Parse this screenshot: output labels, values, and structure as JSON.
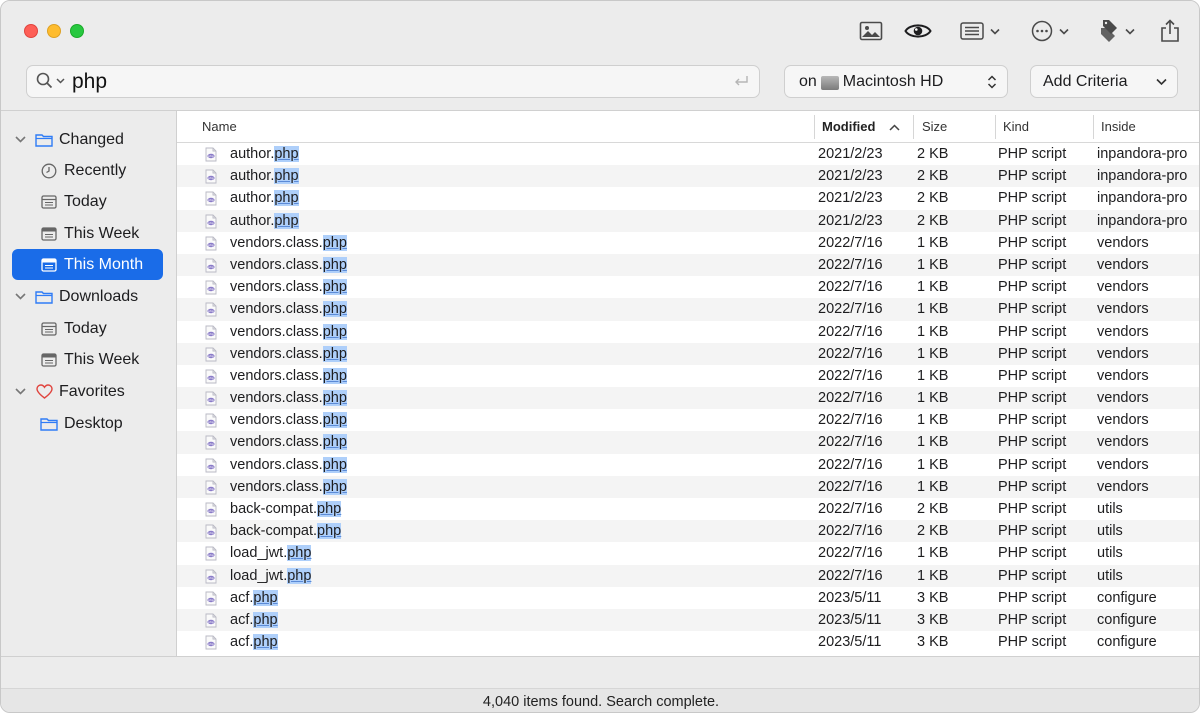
{
  "search": {
    "query": "php"
  },
  "scope": {
    "prefix": "on",
    "volume": "Macintosh HD"
  },
  "criteria": {
    "label": "Add Criteria"
  },
  "toolbar": {
    "icons": [
      "image-icon",
      "eye-icon",
      "list-view-icon",
      "more-icon",
      "tags-icon",
      "share-icon"
    ]
  },
  "sidebar": {
    "groups": [
      {
        "label": "Changed",
        "items": [
          {
            "label": "Recently",
            "icon": "clock-icon"
          },
          {
            "label": "Today",
            "icon": "calendar-icon"
          },
          {
            "label": "This Week",
            "icon": "calendar-icon"
          },
          {
            "label": "This Month",
            "icon": "calendar-icon",
            "selected": true
          }
        ]
      },
      {
        "label": "Downloads",
        "items": [
          {
            "label": "Today",
            "icon": "calendar-icon"
          },
          {
            "label": "This Week",
            "icon": "calendar-icon"
          }
        ]
      },
      {
        "label": "Favorites",
        "items": [
          {
            "label": "Desktop",
            "icon": "folder-icon"
          }
        ]
      }
    ]
  },
  "columns": {
    "name": "Name",
    "modified": "Modified",
    "size": "Size",
    "kind": "Kind",
    "inside": "Inside"
  },
  "rows": [
    {
      "base": "author.",
      "ext": "php",
      "modified": "2021/2/23",
      "size": "2 KB",
      "kind": "PHP script",
      "inside": "inpandora-pro"
    },
    {
      "base": "author.",
      "ext": "php",
      "modified": "2021/2/23",
      "size": "2 KB",
      "kind": "PHP script",
      "inside": "inpandora-pro"
    },
    {
      "base": "author.",
      "ext": "php",
      "modified": "2021/2/23",
      "size": "2 KB",
      "kind": "PHP script",
      "inside": "inpandora-pro"
    },
    {
      "base": "author.",
      "ext": "php",
      "modified": "2021/2/23",
      "size": "2 KB",
      "kind": "PHP script",
      "inside": "inpandora-pro"
    },
    {
      "base": "vendors.class.",
      "ext": "php",
      "modified": "2022/7/16",
      "size": "1 KB",
      "kind": "PHP script",
      "inside": "vendors"
    },
    {
      "base": "vendors.class.",
      "ext": "php",
      "modified": "2022/7/16",
      "size": "1 KB",
      "kind": "PHP script",
      "inside": "vendors"
    },
    {
      "base": "vendors.class.",
      "ext": "php",
      "modified": "2022/7/16",
      "size": "1 KB",
      "kind": "PHP script",
      "inside": "vendors"
    },
    {
      "base": "vendors.class.",
      "ext": "php",
      "modified": "2022/7/16",
      "size": "1 KB",
      "kind": "PHP script",
      "inside": "vendors"
    },
    {
      "base": "vendors.class.",
      "ext": "php",
      "modified": "2022/7/16",
      "size": "1 KB",
      "kind": "PHP script",
      "inside": "vendors"
    },
    {
      "base": "vendors.class.",
      "ext": "php",
      "modified": "2022/7/16",
      "size": "1 KB",
      "kind": "PHP script",
      "inside": "vendors"
    },
    {
      "base": "vendors.class.",
      "ext": "php",
      "modified": "2022/7/16",
      "size": "1 KB",
      "kind": "PHP script",
      "inside": "vendors"
    },
    {
      "base": "vendors.class.",
      "ext": "php",
      "modified": "2022/7/16",
      "size": "1 KB",
      "kind": "PHP script",
      "inside": "vendors"
    },
    {
      "base": "vendors.class.",
      "ext": "php",
      "modified": "2022/7/16",
      "size": "1 KB",
      "kind": "PHP script",
      "inside": "vendors"
    },
    {
      "base": "vendors.class.",
      "ext": "php",
      "modified": "2022/7/16",
      "size": "1 KB",
      "kind": "PHP script",
      "inside": "vendors"
    },
    {
      "base": "vendors.class.",
      "ext": "php",
      "modified": "2022/7/16",
      "size": "1 KB",
      "kind": "PHP script",
      "inside": "vendors"
    },
    {
      "base": "vendors.class.",
      "ext": "php",
      "modified": "2022/7/16",
      "size": "1 KB",
      "kind": "PHP script",
      "inside": "vendors"
    },
    {
      "base": "back-compat.",
      "ext": "php",
      "modified": "2022/7/16",
      "size": "2 KB",
      "kind": "PHP script",
      "inside": "utils"
    },
    {
      "base": "back-compat.",
      "ext": "php",
      "modified": "2022/7/16",
      "size": "2 KB",
      "kind": "PHP script",
      "inside": "utils"
    },
    {
      "base": "load_jwt.",
      "ext": "php",
      "modified": "2022/7/16",
      "size": "1 KB",
      "kind": "PHP script",
      "inside": "utils"
    },
    {
      "base": "load_jwt.",
      "ext": "php",
      "modified": "2022/7/16",
      "size": "1 KB",
      "kind": "PHP script",
      "inside": "utils"
    },
    {
      "base": "acf.",
      "ext": "php",
      "modified": "2023/5/11",
      "size": "3 KB",
      "kind": "PHP script",
      "inside": "configure"
    },
    {
      "base": "acf.",
      "ext": "php",
      "modified": "2023/5/11",
      "size": "3 KB",
      "kind": "PHP script",
      "inside": "configure"
    },
    {
      "base": "acf.",
      "ext": "php",
      "modified": "2023/5/11",
      "size": "3 KB",
      "kind": "PHP script",
      "inside": "configure"
    }
  ],
  "status": "4,040 items found. Search complete.",
  "colors": {
    "accent": "#1a6ce8",
    "highlight": "#aecffa",
    "favorites": "#e0443e"
  }
}
